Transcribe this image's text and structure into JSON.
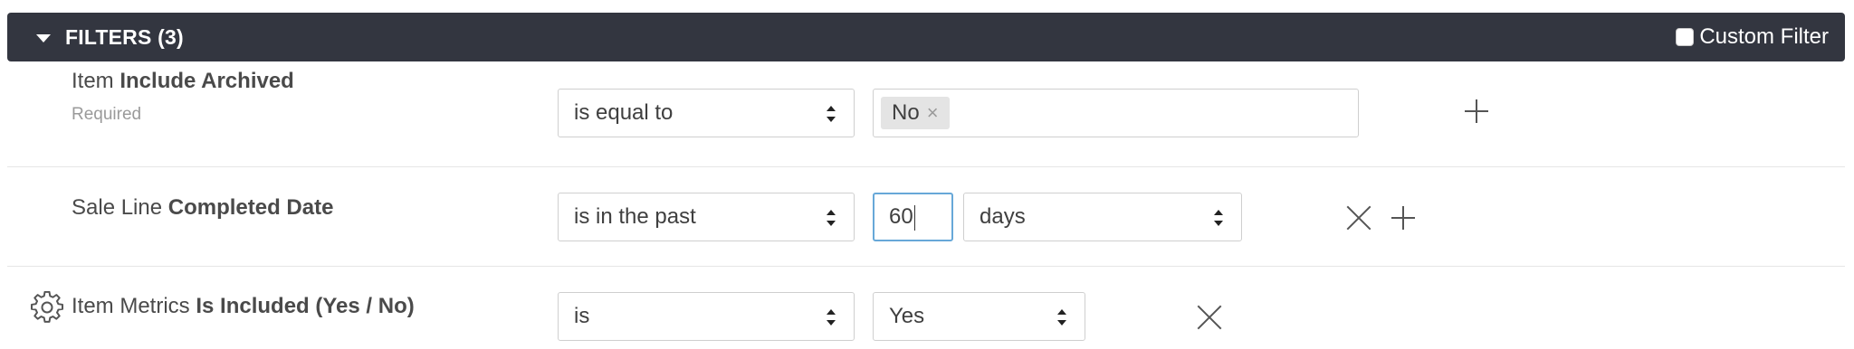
{
  "header": {
    "title": "FILTERS (3)",
    "custom_filter_label": "Custom Filter",
    "custom_filter_checked": false
  },
  "filters": [
    {
      "field_prefix": "Item ",
      "field_name": "Include Archived",
      "required_label": "Required",
      "operator": "is equal to",
      "value_tag": "No",
      "tag_remove": "×"
    },
    {
      "field_prefix": "Sale Line ",
      "field_name": "Completed Date",
      "operator": "is in the past",
      "value_input": "60",
      "unit": "days"
    },
    {
      "field_prefix": "Item Metrics ",
      "field_name": "Is Included (Yes / No)",
      "operator": "is",
      "value_select": "Yes"
    }
  ],
  "icons": {
    "caret": "caret-down-icon",
    "gear": "gear-icon",
    "plus": "plus-icon",
    "remove": "close-icon"
  },
  "colors": {
    "header_bg": "#333640",
    "focus_border": "#67a8d8",
    "tag_bg": "#e4e4e4"
  }
}
